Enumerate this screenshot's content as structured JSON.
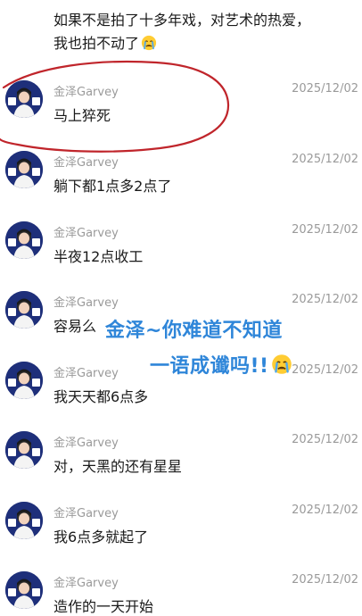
{
  "top_comment": {
    "line1": "如果不是拍了十多年戏，对艺术的热爱，",
    "line2": "我也拍不动了"
  },
  "comments": [
    {
      "name": "金泽Garvey",
      "time": "2025/12/02",
      "text": "马上猝死"
    },
    {
      "name": "金泽Garvey",
      "time": "2025/12/02",
      "text": "躺下都1点多2点了"
    },
    {
      "name": "金泽Garvey",
      "time": "2025/12/02",
      "text": "半夜12点收工"
    },
    {
      "name": "金泽Garvey",
      "time": "2025/12/02",
      "text": "容易么"
    },
    {
      "name": "金泽Garvey",
      "time": "2025/12/02",
      "text": "我天天都6点多"
    },
    {
      "name": "金泽Garvey",
      "time": "2025/12/02",
      "text": "对，天黑的还有星星"
    },
    {
      "name": "金泽Garvey",
      "time": "2025/12/02",
      "text": "我6点多就起了"
    },
    {
      "name": "金泽Garvey",
      "time": "2025/12/02",
      "text": "造作的一天开始"
    }
  ],
  "overlay": {
    "line1": "金泽~你难道不知道",
    "line2": "一语成谶吗!!"
  },
  "icons": {
    "avatar": "avatar-icon",
    "crying_emoji": "crying-face-icon"
  },
  "colors": {
    "overlay_text": "#2f86d9",
    "circle_mark": "#c0252b",
    "meta_text": "#9a9a9a",
    "avatar_bg": "#1e2f7a"
  }
}
